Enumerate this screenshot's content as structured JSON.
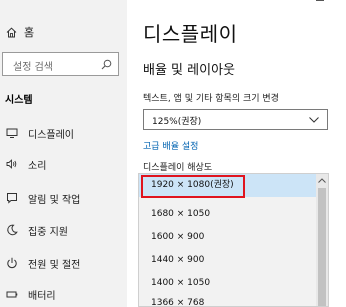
{
  "sidebar": {
    "home_label": "홈",
    "search_placeholder": "설정 검색",
    "section_title": "시스템",
    "items": [
      {
        "label": "디스플레이",
        "icon": "monitor-icon"
      },
      {
        "label": "소리",
        "icon": "speaker-icon"
      },
      {
        "label": "알림 및 작업",
        "icon": "notification-icon"
      },
      {
        "label": "집중 지원",
        "icon": "moon-icon"
      },
      {
        "label": "전원 및 절전",
        "icon": "power-icon"
      },
      {
        "label": "배터리",
        "icon": "battery-icon"
      }
    ]
  },
  "main": {
    "title": "디스플레이",
    "section": "배율 및 레이아웃",
    "scale_label": "텍스트, 앱 및 기타 항목의 크기 변경",
    "scale_value": "125%(권장)",
    "advanced_link": "고급 배율 설정",
    "resolution_label": "디스플레이 해상도",
    "resolution_options": [
      "1920 × 1080(권장)",
      "1680 × 1050",
      "1600 × 900",
      "1440 × 900",
      "1400 × 1050",
      "1366 × 768"
    ],
    "selected_index": 0
  },
  "colors": {
    "sidebar_bg": "#f2f2f2",
    "link": "#0063b1",
    "selected_option": "#cce4f7",
    "highlight_border": "#e0141e"
  }
}
